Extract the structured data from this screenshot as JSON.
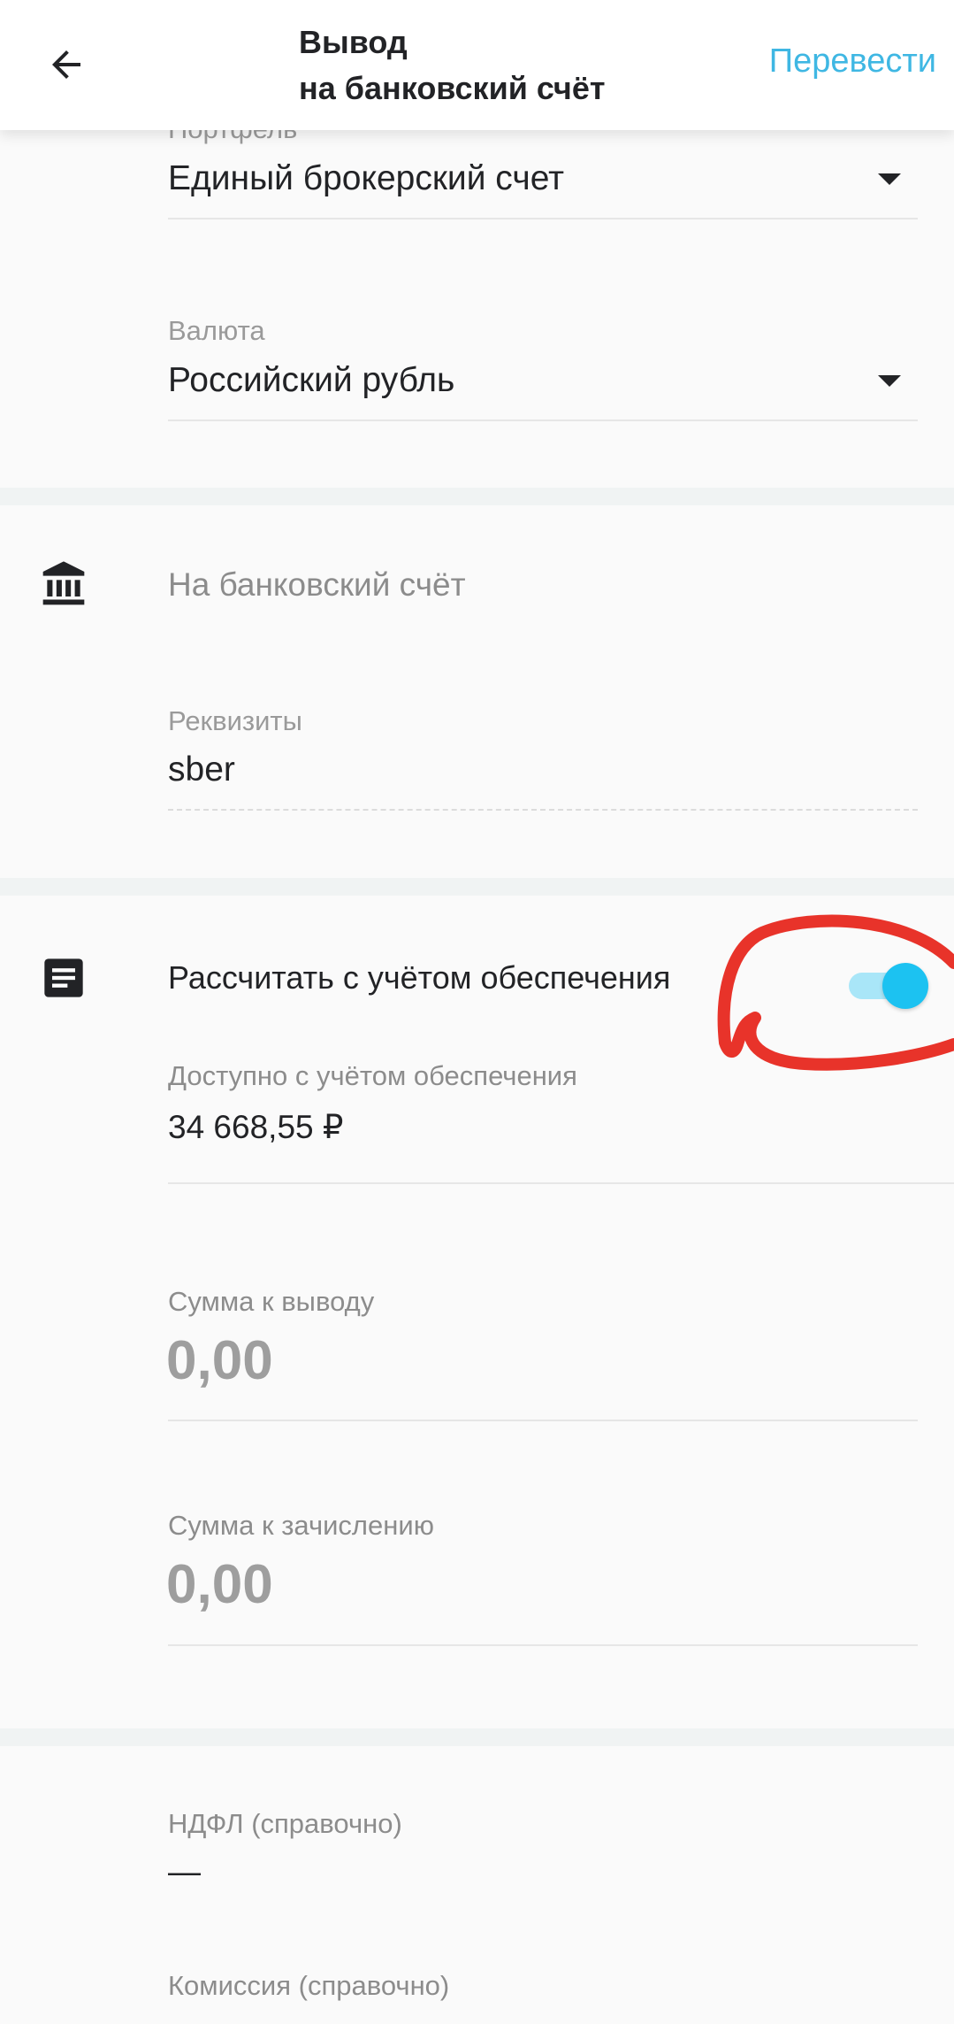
{
  "header": {
    "title_line1": "Вывод",
    "title_line2": "на банковский счёт",
    "action_label": "Перевести",
    "back_icon": "arrow-left-icon"
  },
  "portfolio": {
    "label": "Портфель",
    "value": "Единый брокерский счет"
  },
  "currency": {
    "label": "Валюта",
    "value": "Российский рубль"
  },
  "bank_section": {
    "icon": "bank-icon",
    "title": "На банковский счёт",
    "requisites_label": "Реквизиты",
    "requisites_value": "sber"
  },
  "collateral_section": {
    "icon": "document-icon",
    "title": "Рассчитать с учётом обеспечения",
    "toggle_on": true,
    "available_label": "Доступно с учётом обеспечения",
    "available_value": "34 668,55 ₽"
  },
  "withdraw": {
    "label": "Сумма к выводу",
    "value": "0,00"
  },
  "credit": {
    "label": "Сумма к зачислению",
    "value": "0,00"
  },
  "ndfl": {
    "label": "НДФЛ (справочно)",
    "value": "—"
  },
  "commission": {
    "label": "Комиссия (справочно)"
  },
  "colors": {
    "accent": "#3fb7e3",
    "toggle_thumb": "#1cc2f1",
    "annotation": "#e8332a"
  }
}
